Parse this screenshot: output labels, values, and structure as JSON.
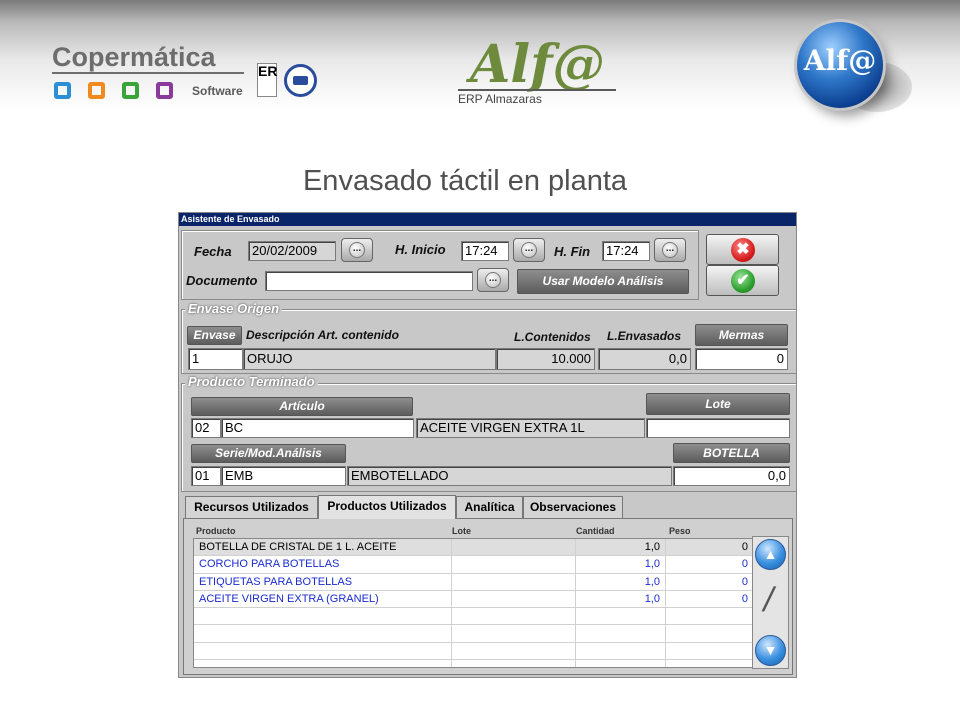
{
  "header": {
    "company": "Copermática",
    "company_sub": "Software",
    "product_logo": "Alf@",
    "product_sub": "ERP Almazaras",
    "sphere_logo": "Alf@",
    "cert_label": "ER"
  },
  "page_title": "Envasado táctil en planta",
  "window": {
    "title": "Asistente de Envasado",
    "fecha_label": "Fecha",
    "fecha_value": "20/02/2009",
    "hinicio_label": "H. Inicio",
    "hinicio_value": "17:24",
    "hfin_label": "H. Fin",
    "hfin_value": "17:24",
    "documento_label": "Documento",
    "documento_value": "",
    "dots_label": "...",
    "usar_modelo_label": "Usar Modelo Análisis",
    "cancel_icon": "✖",
    "ok_icon": "✔"
  },
  "envase_origen": {
    "title": "Envase Origen",
    "envase_label": "Envase",
    "descripcion_label": "Descripción Art. contenido",
    "lcontenidos_label": "L.Contenidos",
    "lenvasados_label": "L.Envasados",
    "mermas_label": "Mermas",
    "envase_value": "1",
    "descripcion_value": "ORUJO",
    "lcontenidos_value": "10.000",
    "lenvasados_value": "0,0",
    "mermas_value": "0"
  },
  "producto_terminado": {
    "title": "Producto Terminado",
    "articulo_label": "Artículo",
    "lote_label": "Lote",
    "articulo_code": "02",
    "articulo_ref": "BC",
    "articulo_desc": "ACEITE VIRGEN EXTRA 1L",
    "lote_value": "",
    "serie_label": "Serie/Mod.Análisis",
    "botella_label": "BOTELLA",
    "serie_code": "01",
    "serie_ref": "EMB",
    "serie_desc": "EMBOTELLADO",
    "botella_value": "0,0"
  },
  "tabs": [
    {
      "label": "Recursos Utilizados"
    },
    {
      "label": "Productos Utilizados"
    },
    {
      "label": "Analítica"
    },
    {
      "label": "Observaciones"
    }
  ],
  "grid": {
    "columns": [
      "Producto",
      "Lote",
      "Cantidad",
      "Peso"
    ],
    "rows": [
      {
        "producto": "BOTELLA DE CRISTAL DE 1 L. ACEITE",
        "lote": "",
        "cantidad": "1,0",
        "peso": "0"
      },
      {
        "producto": "CORCHO PARA BOTELLAS",
        "lote": "",
        "cantidad": "1,0",
        "peso": "0"
      },
      {
        "producto": "ETIQUETAS PARA BOTELLAS",
        "lote": "",
        "cantidad": "1,0",
        "peso": "0"
      },
      {
        "producto": "ACEITE VIRGEN EXTRA (GRANEL)",
        "lote": "",
        "cantidad": "1,0",
        "peso": "0"
      },
      {
        "producto": "",
        "lote": "",
        "cantidad": "",
        "peso": ""
      },
      {
        "producto": "",
        "lote": "",
        "cantidad": "",
        "peso": ""
      },
      {
        "producto": "",
        "lote": "",
        "cantidad": "",
        "peso": ""
      },
      {
        "producto": "",
        "lote": "",
        "cantidad": "",
        "peso": ""
      }
    ],
    "up_icon": "▲",
    "edit_icon": "/",
    "down_icon": "▼"
  },
  "colors": {
    "titlebar": "#0a246a",
    "window_bg": "#c8c8c8",
    "row_text": "#1a2bd0",
    "cancel_red": "#d82020",
    "ok_green": "#2ea02e"
  }
}
